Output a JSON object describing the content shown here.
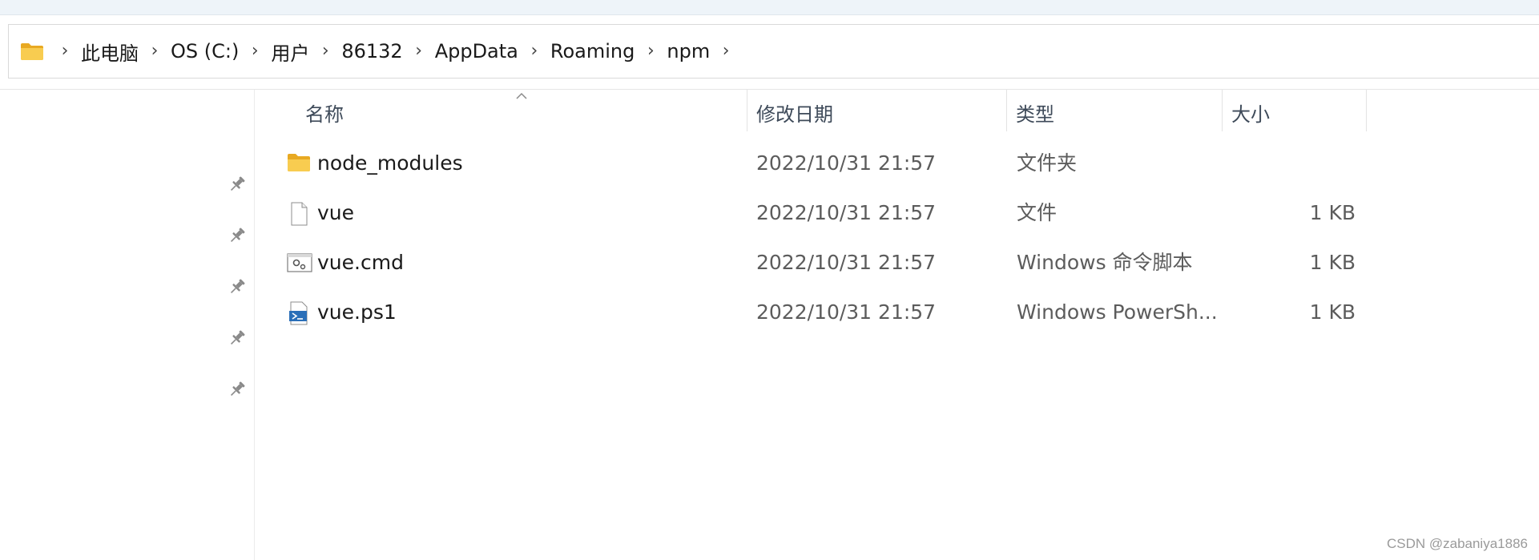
{
  "breadcrumb": {
    "items": [
      "此电脑",
      "OS (C:)",
      "用户",
      "86132",
      "AppData",
      "Roaming",
      "npm"
    ],
    "separator": "›"
  },
  "columns": {
    "name": "名称",
    "date": "修改日期",
    "type": "类型",
    "size": "大小"
  },
  "files": [
    {
      "name": "node_modules",
      "date": "2022/10/31 21:57",
      "type": "文件夹",
      "size": "",
      "icon": "folder-icon"
    },
    {
      "name": "vue",
      "date": "2022/10/31 21:57",
      "type": "文件",
      "size": "1 KB",
      "icon": "file-icon"
    },
    {
      "name": "vue.cmd",
      "date": "2022/10/31 21:57",
      "type": "Windows 命令脚本",
      "size": "1 KB",
      "icon": "cmd-script-icon"
    },
    {
      "name": "vue.ps1",
      "date": "2022/10/31 21:57",
      "type": "Windows PowerSh...",
      "size": "1 KB",
      "icon": "powershell-script-icon"
    }
  ],
  "sidebar": {
    "pins": [
      "pin-icon",
      "pin-icon",
      "pin-icon",
      "pin-icon",
      "pin-icon"
    ]
  },
  "watermark": "CSDN @zabaniya1886",
  "colors": {
    "folder": "#f5c445",
    "header_text": "#3e4a59",
    "secondary_text": "#5c5c5c"
  }
}
